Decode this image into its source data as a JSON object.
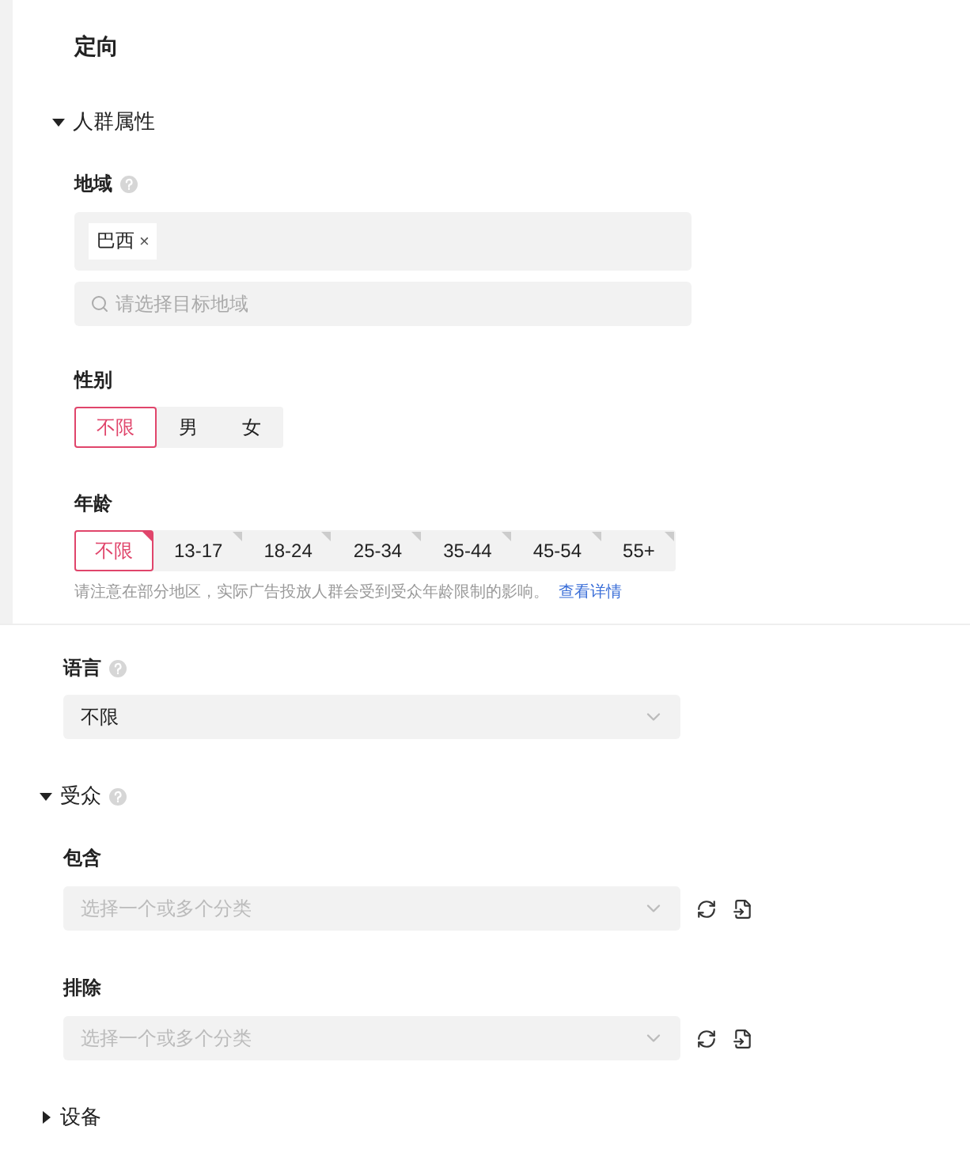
{
  "title": "定向",
  "demographics": {
    "label": "人群属性",
    "expanded": true,
    "location": {
      "label": "地域",
      "tags": [
        {
          "label": "巴西",
          "remove": "×"
        }
      ],
      "search": {
        "placeholder": "请选择目标地域"
      }
    },
    "gender": {
      "label": "性别",
      "options": [
        {
          "label": "不限",
          "selected": true
        },
        {
          "label": "男",
          "selected": false
        },
        {
          "label": "女",
          "selected": false
        }
      ]
    },
    "age": {
      "label": "年龄",
      "options": [
        {
          "label": "不限",
          "selected": true
        },
        {
          "label": "13-17",
          "selected": false
        },
        {
          "label": "18-24",
          "selected": false
        },
        {
          "label": "25-34",
          "selected": false
        },
        {
          "label": "35-44",
          "selected": false
        },
        {
          "label": "45-54",
          "selected": false
        },
        {
          "label": "55+",
          "selected": false
        }
      ],
      "note": "请注意在部分地区，实际广告投放人群会受到受众年龄限制的影响。",
      "link": "查看详情"
    }
  },
  "language": {
    "label": "语言",
    "value": "不限"
  },
  "audience": {
    "label": "受众",
    "expanded": true,
    "include": {
      "label": "包含",
      "placeholder": "选择一个或多个分类"
    },
    "exclude": {
      "label": "排除",
      "placeholder": "选择一个或多个分类"
    }
  },
  "device": {
    "label": "设备",
    "expanded": false
  }
}
